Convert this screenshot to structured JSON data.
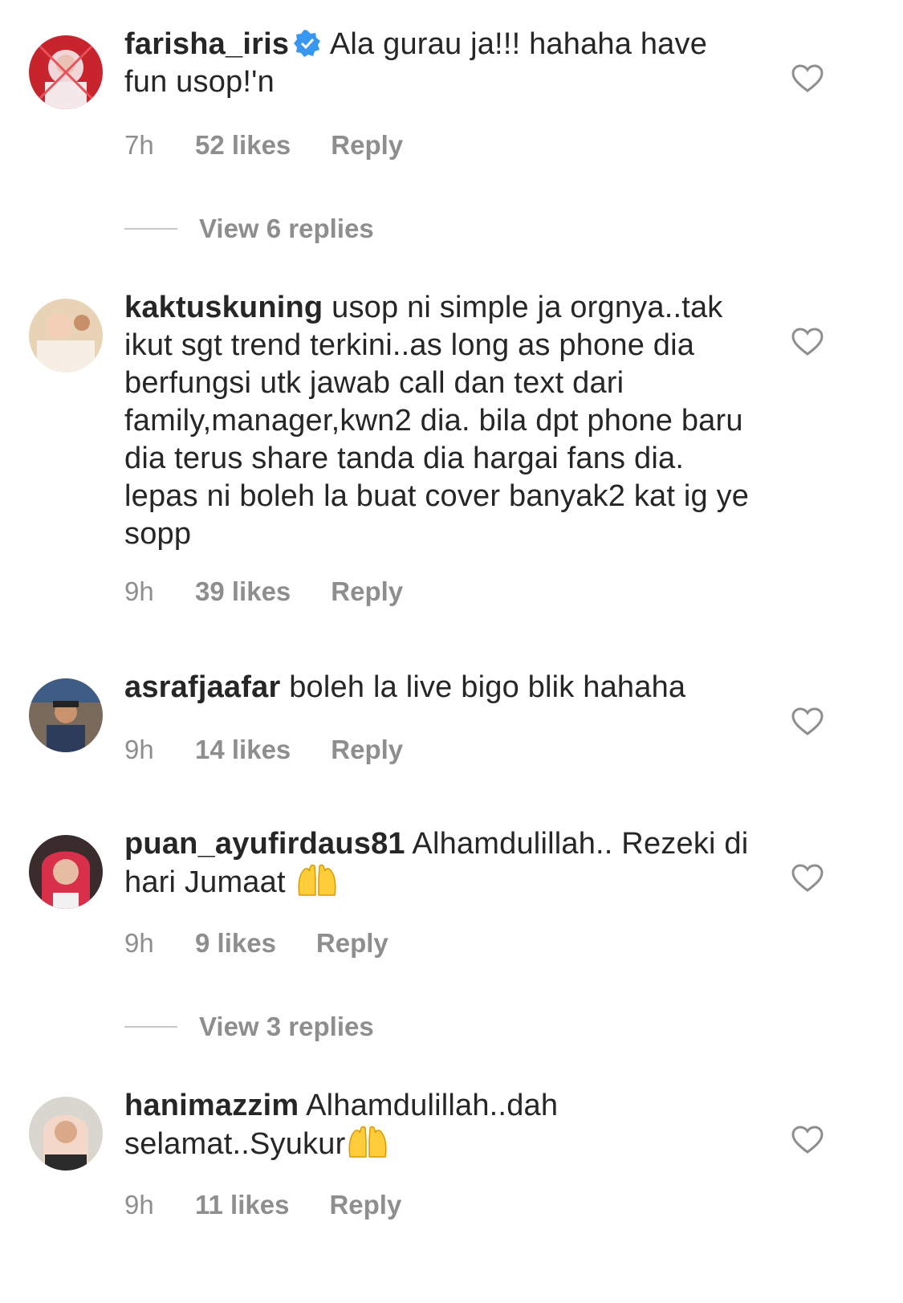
{
  "comments": [
    {
      "username": "farisha_iris",
      "verified": true,
      "text": "Ala gurau ja!!! hahaha have fun usop!'n",
      "time": "7h",
      "likes": "52 likes",
      "reply": "Reply",
      "view_replies": "View 6 replies"
    },
    {
      "username": "kaktuskuning",
      "text": "usop ni simple ja orgnya..tak ikut sgt trend terkini..as long as phone dia berfungsi utk jawab call dan text dari family,manager,kwn2 dia. bila dpt phone baru dia terus share tanda dia hargai fans dia. lepas ni boleh la buat cover banyak2 kat ig ye sopp",
      "time": "9h",
      "likes": "39 likes",
      "reply": "Reply"
    },
    {
      "username": "asrafjaafar",
      "text": "boleh la live bigo blik hahaha",
      "time": "9h",
      "likes": "14 likes",
      "reply": "Reply"
    },
    {
      "username": "puan_ayufirdaus81",
      "text": "Alhamdulillah.. Rezeki di hari Jumaat",
      "time": "9h",
      "likes": "9 likes",
      "reply": "Reply",
      "view_replies": "View 3 replies"
    },
    {
      "username": "hanimazzim",
      "text": "Alhamdulillah..dah selamat..Syukur",
      "time": "9h",
      "likes": "11 likes",
      "reply": "Reply"
    }
  ],
  "icons": {
    "heart": "heart-outline-icon",
    "verified": "verified-badge-icon",
    "emoji": "raising-hands-emoji"
  },
  "colors": {
    "text": "#262626",
    "meta": "#8e8e8e",
    "verified": "#3897f0"
  }
}
